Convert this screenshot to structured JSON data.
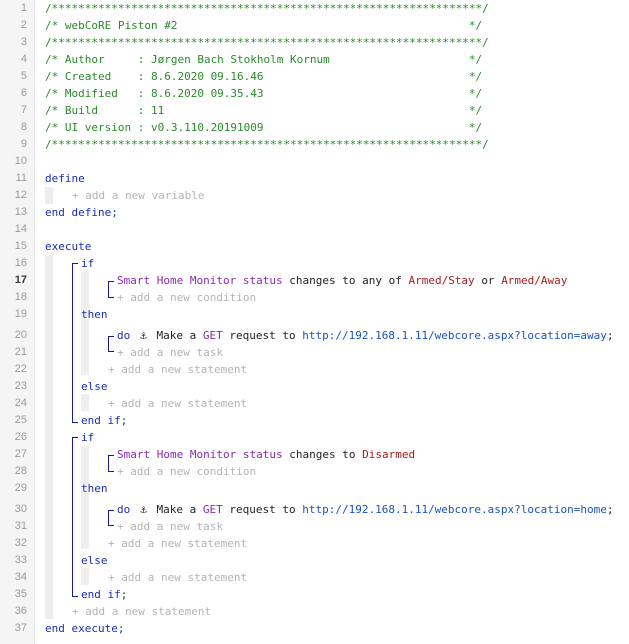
{
  "gutter": {
    "line_numbers": [
      "1",
      "2",
      "3",
      "4",
      "5",
      "6",
      "7",
      "8",
      "9",
      "10",
      "11",
      "12",
      "13",
      "14",
      "15",
      "16",
      "17",
      "18",
      "19",
      "20",
      "21",
      "22",
      "23",
      "24",
      "25",
      "26",
      "27",
      "28",
      "29",
      "30",
      "31",
      "32",
      "33",
      "34",
      "35",
      "36",
      "37"
    ],
    "current_line": "17"
  },
  "header": {
    "border": "/*****************************************************************/",
    "title": "/* webCoRE Piston #2                                            */",
    "author": "/* Author     : Jørgen Bach Stokholm Kornum                     */",
    "created": "/* Created    : 8.6.2020 09.16.46                               */",
    "modified": "/* Modified   : 8.6.2020 09.35.43                               */",
    "build": "/* Build      : 11                                              */",
    "ui": "/* UI version : v0.3.110.20191009                               */"
  },
  "code": {
    "define": "define",
    "add_variable": "+ add a new variable",
    "end_define": "end define;",
    "execute": "execute",
    "if": "if",
    "then": "then",
    "else": "else",
    "end_if": "end if;",
    "add_condition": "+ add a new condition",
    "add_task": "+ add a new task",
    "add_statement": "+ add a new statement",
    "end_execute": "end execute;",
    "do": "do",
    "anchor_icon": "⚓",
    "device_smart": "Smart",
    "device_home": "Home",
    "device_monitor": "Monitor",
    "attr_status": "status",
    "changes_any": "changes to any of",
    "changes_to": "changes to",
    "or": "or",
    "armed_stay": "Armed/Stay",
    "armed_away": "Armed/Away",
    "disarmed": "Disarmed",
    "make_a": "Make a",
    "get": "GET",
    "request_to": "request to",
    "url_away": "http://192.168.1.11/webcore.aspx?location=away",
    "url_home": "http://192.168.1.11/webcore.aspx?location=home",
    "semicolon": ";"
  },
  "colors": {
    "comment": "#2a8a2a",
    "keyword": "#1a2fb0",
    "placeholder": "#b4b4b4",
    "device": "#8a2ab0",
    "value": "#a41c1c",
    "url": "#1a52c2"
  }
}
